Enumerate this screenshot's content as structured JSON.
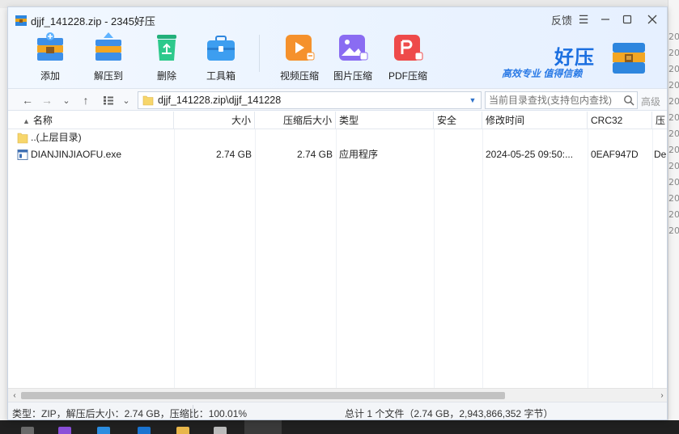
{
  "window": {
    "title": "djjf_141228.zip - 2345好压",
    "feedback_label": "反馈",
    "menu_icon": "hamburger-menu-icon",
    "min_icon": "minimize-icon",
    "max_icon": "maximize-icon",
    "close_icon": "close-icon"
  },
  "toolbar": {
    "items": [
      {
        "label": "添加",
        "icon": "add-box-icon"
      },
      {
        "label": "解压到",
        "icon": "extract-box-icon"
      },
      {
        "label": "删除",
        "icon": "recycle-bin-icon"
      },
      {
        "label": "工具箱",
        "icon": "toolbox-icon"
      },
      {
        "label": "视频压缩",
        "icon": "video-compress-icon"
      },
      {
        "label": "图片压缩",
        "icon": "image-compress-icon"
      },
      {
        "label": "PDF压缩",
        "icon": "pdf-compress-icon"
      }
    ]
  },
  "brand": {
    "name": "好压",
    "slogan": "高效专业  值得信赖"
  },
  "addressbar": {
    "path": "djjf_141228.zip\\djjf_141228",
    "search_placeholder": "当前目录查找(支持包内查找)",
    "advanced_label": "高级"
  },
  "columns": [
    {
      "key": "name",
      "label": "名称"
    },
    {
      "key": "size",
      "label": "大小"
    },
    {
      "key": "packed",
      "label": "压缩后大小"
    },
    {
      "key": "type",
      "label": "类型"
    },
    {
      "key": "security",
      "label": "安全"
    },
    {
      "key": "modified",
      "label": "修改时间"
    },
    {
      "key": "crc",
      "label": "CRC32"
    },
    {
      "key": "method",
      "label": "压"
    }
  ],
  "rows": [
    {
      "name": "..(上层目录)",
      "size": "",
      "packed": "",
      "type": "",
      "security": "",
      "modified": "",
      "crc": "",
      "method": "",
      "icon": "folder-icon"
    },
    {
      "name": "DIANJINJIAOFU.exe",
      "size": "2.74 GB",
      "packed": "2.74 GB",
      "type": "应用程序",
      "security": "",
      "modified": "2024-05-25 09:50:...",
      "crc": "0EAF947D",
      "method": "De",
      "icon": "exe-file-icon"
    }
  ],
  "status": {
    "left": "类型：ZIP，解压后大小：2.74 GB，压缩比：100.01%",
    "right": "总计 1 个文件（2.74 GB，2,943,866,352 字节）"
  },
  "background": {
    "side_labels": [
      "20",
      "20",
      "20",
      "20",
      "20",
      "20",
      "20",
      "20",
      "20",
      "20",
      "20",
      "20",
      "20"
    ]
  }
}
